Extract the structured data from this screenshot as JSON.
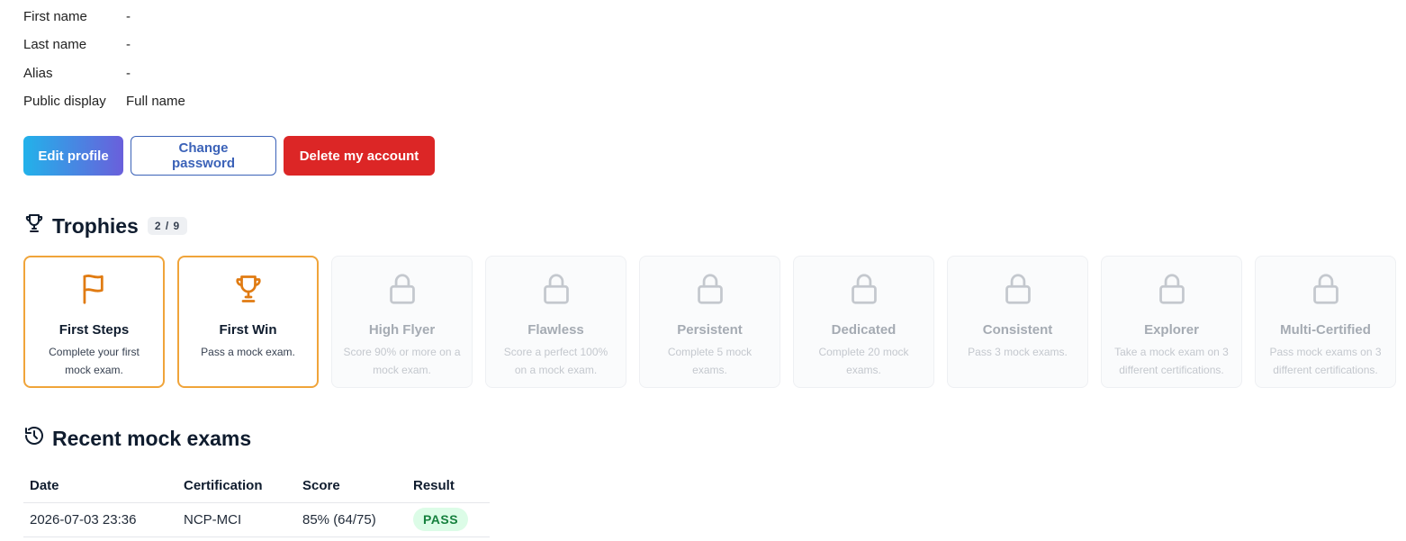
{
  "profile": {
    "fields": [
      {
        "label": "First name",
        "value": "-"
      },
      {
        "label": "Last name",
        "value": "-"
      },
      {
        "label": "Alias",
        "value": "-"
      },
      {
        "label": "Public display",
        "value": "Full name"
      }
    ]
  },
  "actions": {
    "edit_label": "Edit profile",
    "change_password_label": "Change password",
    "delete_label": "Delete my account"
  },
  "trophies": {
    "title": "Trophies",
    "count": "2 / 9",
    "items": [
      {
        "name": "First Steps",
        "desc": "Complete your first mock exam.",
        "icon": "flag-icon",
        "unlocked": true
      },
      {
        "name": "First Win",
        "desc": "Pass a mock exam.",
        "icon": "trophy-icon",
        "unlocked": true
      },
      {
        "name": "High Flyer",
        "desc": "Score 90% or more on a mock exam.",
        "icon": "lock-icon",
        "unlocked": false
      },
      {
        "name": "Flawless",
        "desc": "Score a perfect 100% on a mock exam.",
        "icon": "lock-icon",
        "unlocked": false
      },
      {
        "name": "Persistent",
        "desc": "Complete 5 mock exams.",
        "icon": "lock-icon",
        "unlocked": false
      },
      {
        "name": "Dedicated",
        "desc": "Complete 20 mock exams.",
        "icon": "lock-icon",
        "unlocked": false
      },
      {
        "name": "Consistent",
        "desc": "Pass 3 mock exams.",
        "icon": "lock-icon",
        "unlocked": false
      },
      {
        "name": "Explorer",
        "desc": "Take a mock exam on 3 different certifications.",
        "icon": "lock-icon",
        "unlocked": false
      },
      {
        "name": "Multi-Certified",
        "desc": "Pass mock exams on 3 different certifications.",
        "icon": "lock-icon",
        "unlocked": false
      }
    ]
  },
  "recent": {
    "title": "Recent mock exams",
    "columns": [
      "Date",
      "Certification",
      "Score",
      "Result"
    ],
    "rows": [
      {
        "date": "2026-07-03 23:36",
        "certification": "NCP-MCI",
        "score": "85% (64/75)",
        "result": "PASS"
      }
    ]
  },
  "colors": {
    "accent_gradient_start": "#22b2ea",
    "accent_gradient_end": "#6a5fdb",
    "danger": "#dc2626",
    "unlocked_border": "#f0a43a",
    "unlocked_icon": "#e07b12",
    "pass_bg": "#dcfce7",
    "pass_text": "#15803d"
  }
}
